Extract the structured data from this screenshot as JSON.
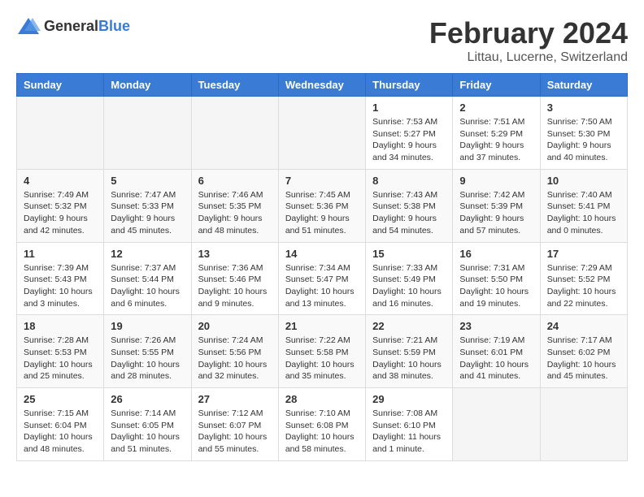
{
  "header": {
    "logo_general": "General",
    "logo_blue": "Blue",
    "month_year": "February 2024",
    "location": "Littau, Lucerne, Switzerland"
  },
  "days_of_week": [
    "Sunday",
    "Monday",
    "Tuesday",
    "Wednesday",
    "Thursday",
    "Friday",
    "Saturday"
  ],
  "weeks": [
    [
      {
        "day": "",
        "info": ""
      },
      {
        "day": "",
        "info": ""
      },
      {
        "day": "",
        "info": ""
      },
      {
        "day": "",
        "info": ""
      },
      {
        "day": "1",
        "info": "Sunrise: 7:53 AM\nSunset: 5:27 PM\nDaylight: 9 hours and 34 minutes."
      },
      {
        "day": "2",
        "info": "Sunrise: 7:51 AM\nSunset: 5:29 PM\nDaylight: 9 hours and 37 minutes."
      },
      {
        "day": "3",
        "info": "Sunrise: 7:50 AM\nSunset: 5:30 PM\nDaylight: 9 hours and 40 minutes."
      }
    ],
    [
      {
        "day": "4",
        "info": "Sunrise: 7:49 AM\nSunset: 5:32 PM\nDaylight: 9 hours and 42 minutes."
      },
      {
        "day": "5",
        "info": "Sunrise: 7:47 AM\nSunset: 5:33 PM\nDaylight: 9 hours and 45 minutes."
      },
      {
        "day": "6",
        "info": "Sunrise: 7:46 AM\nSunset: 5:35 PM\nDaylight: 9 hours and 48 minutes."
      },
      {
        "day": "7",
        "info": "Sunrise: 7:45 AM\nSunset: 5:36 PM\nDaylight: 9 hours and 51 minutes."
      },
      {
        "day": "8",
        "info": "Sunrise: 7:43 AM\nSunset: 5:38 PM\nDaylight: 9 hours and 54 minutes."
      },
      {
        "day": "9",
        "info": "Sunrise: 7:42 AM\nSunset: 5:39 PM\nDaylight: 9 hours and 57 minutes."
      },
      {
        "day": "10",
        "info": "Sunrise: 7:40 AM\nSunset: 5:41 PM\nDaylight: 10 hours and 0 minutes."
      }
    ],
    [
      {
        "day": "11",
        "info": "Sunrise: 7:39 AM\nSunset: 5:43 PM\nDaylight: 10 hours and 3 minutes."
      },
      {
        "day": "12",
        "info": "Sunrise: 7:37 AM\nSunset: 5:44 PM\nDaylight: 10 hours and 6 minutes."
      },
      {
        "day": "13",
        "info": "Sunrise: 7:36 AM\nSunset: 5:46 PM\nDaylight: 10 hours and 9 minutes."
      },
      {
        "day": "14",
        "info": "Sunrise: 7:34 AM\nSunset: 5:47 PM\nDaylight: 10 hours and 13 minutes."
      },
      {
        "day": "15",
        "info": "Sunrise: 7:33 AM\nSunset: 5:49 PM\nDaylight: 10 hours and 16 minutes."
      },
      {
        "day": "16",
        "info": "Sunrise: 7:31 AM\nSunset: 5:50 PM\nDaylight: 10 hours and 19 minutes."
      },
      {
        "day": "17",
        "info": "Sunrise: 7:29 AM\nSunset: 5:52 PM\nDaylight: 10 hours and 22 minutes."
      }
    ],
    [
      {
        "day": "18",
        "info": "Sunrise: 7:28 AM\nSunset: 5:53 PM\nDaylight: 10 hours and 25 minutes."
      },
      {
        "day": "19",
        "info": "Sunrise: 7:26 AM\nSunset: 5:55 PM\nDaylight: 10 hours and 28 minutes."
      },
      {
        "day": "20",
        "info": "Sunrise: 7:24 AM\nSunset: 5:56 PM\nDaylight: 10 hours and 32 minutes."
      },
      {
        "day": "21",
        "info": "Sunrise: 7:22 AM\nSunset: 5:58 PM\nDaylight: 10 hours and 35 minutes."
      },
      {
        "day": "22",
        "info": "Sunrise: 7:21 AM\nSunset: 5:59 PM\nDaylight: 10 hours and 38 minutes."
      },
      {
        "day": "23",
        "info": "Sunrise: 7:19 AM\nSunset: 6:01 PM\nDaylight: 10 hours and 41 minutes."
      },
      {
        "day": "24",
        "info": "Sunrise: 7:17 AM\nSunset: 6:02 PM\nDaylight: 10 hours and 45 minutes."
      }
    ],
    [
      {
        "day": "25",
        "info": "Sunrise: 7:15 AM\nSunset: 6:04 PM\nDaylight: 10 hours and 48 minutes."
      },
      {
        "day": "26",
        "info": "Sunrise: 7:14 AM\nSunset: 6:05 PM\nDaylight: 10 hours and 51 minutes."
      },
      {
        "day": "27",
        "info": "Sunrise: 7:12 AM\nSunset: 6:07 PM\nDaylight: 10 hours and 55 minutes."
      },
      {
        "day": "28",
        "info": "Sunrise: 7:10 AM\nSunset: 6:08 PM\nDaylight: 10 hours and 58 minutes."
      },
      {
        "day": "29",
        "info": "Sunrise: 7:08 AM\nSunset: 6:10 PM\nDaylight: 11 hours and 1 minute."
      },
      {
        "day": "",
        "info": ""
      },
      {
        "day": "",
        "info": ""
      }
    ]
  ]
}
